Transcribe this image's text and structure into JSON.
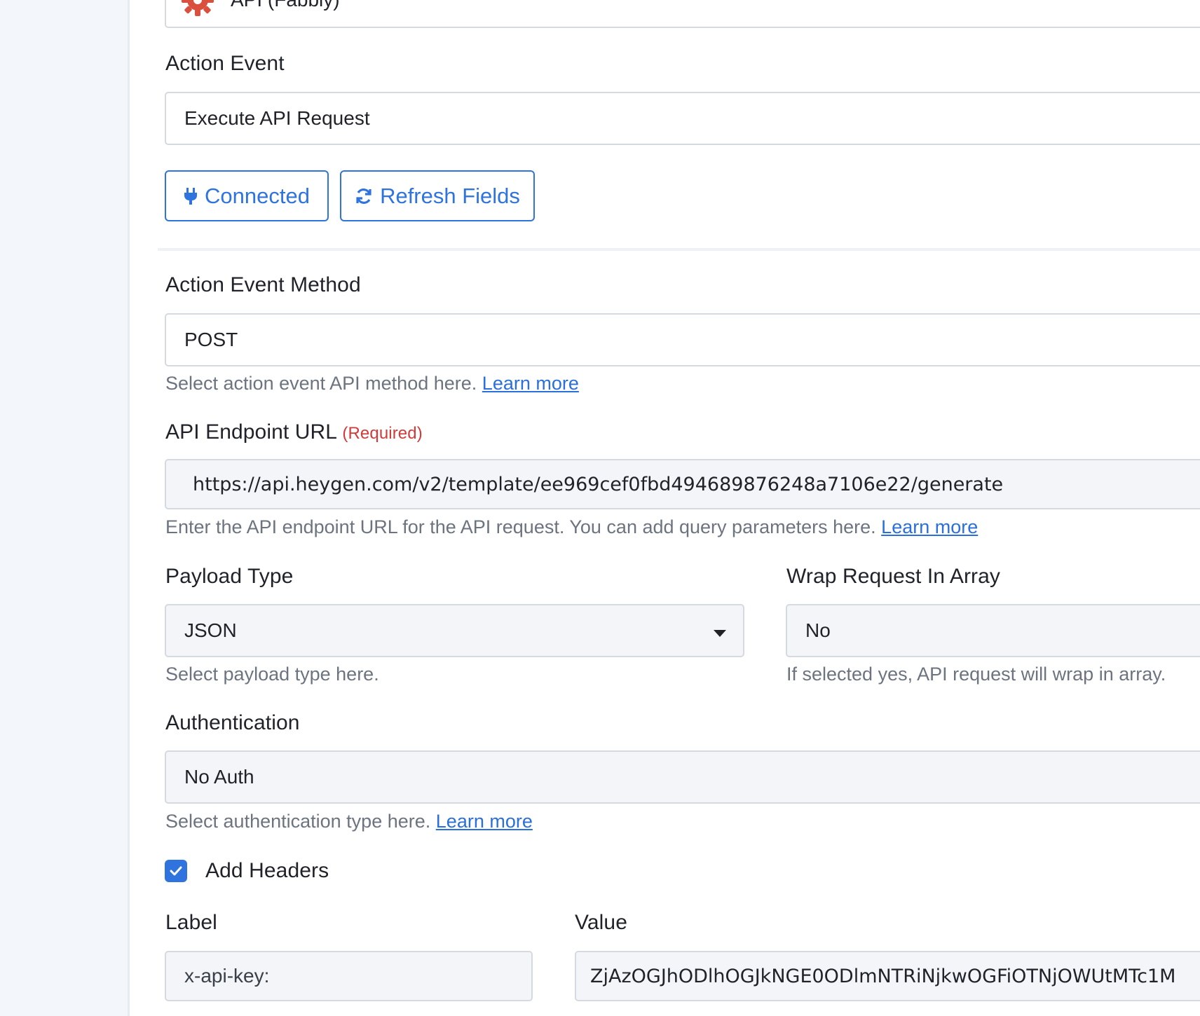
{
  "app": {
    "title": "API (Fabbly)",
    "icon": "gear-icon",
    "accent_color": "#2f73de",
    "required_color": "#d33a3a"
  },
  "action_event": {
    "label": "Action Event",
    "value": "Execute API Request"
  },
  "buttons": {
    "connected": "Connected",
    "refresh": "Refresh Fields"
  },
  "method": {
    "label": "Action Event Method",
    "value": "POST",
    "help": "Select action event API method here.",
    "help_link": "Learn more"
  },
  "endpoint": {
    "label": "API Endpoint URL",
    "required": "(Required)",
    "value": "https://api.heygen.com/v2/template/ee969cef0fbd494689876248a7106e22/generate",
    "help": "Enter the API endpoint URL for the API request. You can add query parameters here.",
    "help_link": "Learn more"
  },
  "payload": {
    "label": "Payload Type",
    "value": "JSON",
    "help": "Select payload type here."
  },
  "wrap": {
    "label": "Wrap Request In Array",
    "value": "No",
    "help": "If selected yes, API request will wrap in array."
  },
  "auth": {
    "label": "Authentication",
    "value": "No Auth",
    "help": "Select authentication type here.",
    "help_link": "Learn more"
  },
  "headers": {
    "checkbox_label": "Add Headers",
    "checked": true,
    "label_header": "Label",
    "value_header": "Value",
    "rows": [
      {
        "label": "x-api-key:",
        "value": "ZjAzOGJhODlhOGJkNGE0ODlmNTRiNjkwOGFiOTNjOWUtMTc1M"
      }
    ]
  }
}
